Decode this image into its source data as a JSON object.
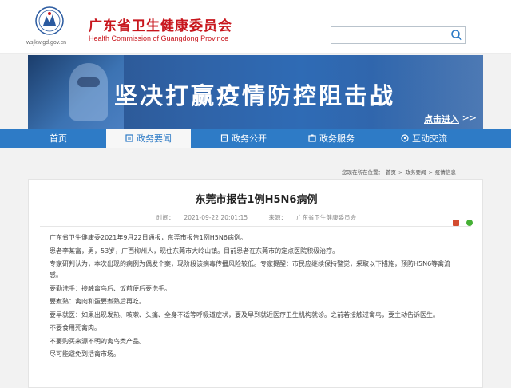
{
  "header": {
    "url_text": "wsjkw.gd.gov.cn",
    "title": "广东省卫生健康委员会",
    "subtitle": "Health Commission of Guangdong Province",
    "search": {
      "value": "",
      "placeholder": ""
    }
  },
  "banner": {
    "title": "坚决打赢疫情防控阻击战",
    "more_label": "点击进入",
    "more_arrows": ">>"
  },
  "nav": {
    "items": [
      {
        "label": "首页",
        "icon": ""
      },
      {
        "label": "政务要闻",
        "icon": "news-icon",
        "active": true
      },
      {
        "label": "政务公开",
        "icon": "doc-icon"
      },
      {
        "label": "政务服务",
        "icon": "service-icon"
      },
      {
        "label": "互动交流",
        "icon": "chat-icon"
      }
    ]
  },
  "breadcrumb": {
    "prefix": "您现在所在位置：",
    "items": [
      "首页",
      "政务要闻",
      "疫情信息"
    ],
    "separator": ">"
  },
  "article": {
    "title": "东莞市报告1例H5N6病例",
    "time_label": "时间：",
    "time": "2021-09-22 20:01:15",
    "source_label": "来源：",
    "source": "广东省卫生健康委员会",
    "paragraphs": [
      "广东省卫生健康委2021年9月22日通报，东莞市报告1例H5N6病例。",
      "患者李某富，男，53岁，广西柳州人，现住东莞市大岭山镇。目前患者在东莞市的定点医院积极治疗。",
      "专家研判认为，本次出现的病例为偶发个案，现阶段该病毒传播风险较低。专家提醒：市民应继续保持警觉，采取以下措施，预防H5N6等禽流感。",
      "要勤洗手：接触禽鸟后、饭前便后要洗手。",
      "要煮熟：禽肉和蛋要煮熟后再吃。",
      "要早就医：如果出现发热、咳嗽、头痛、全身不适等呼吸道症状，要及早到就近医疗卫生机构就诊。之前若接触过禽鸟，要主动告诉医生。",
      "不要食用死禽肉。",
      "不要购买来源不明的禽鸟类产品。",
      "尽可能避免到活禽市场。"
    ]
  },
  "colors": {
    "brand_red": "#c8161d",
    "nav_blue": "#2e7bc6",
    "banner_blue": "#2f62a6"
  }
}
